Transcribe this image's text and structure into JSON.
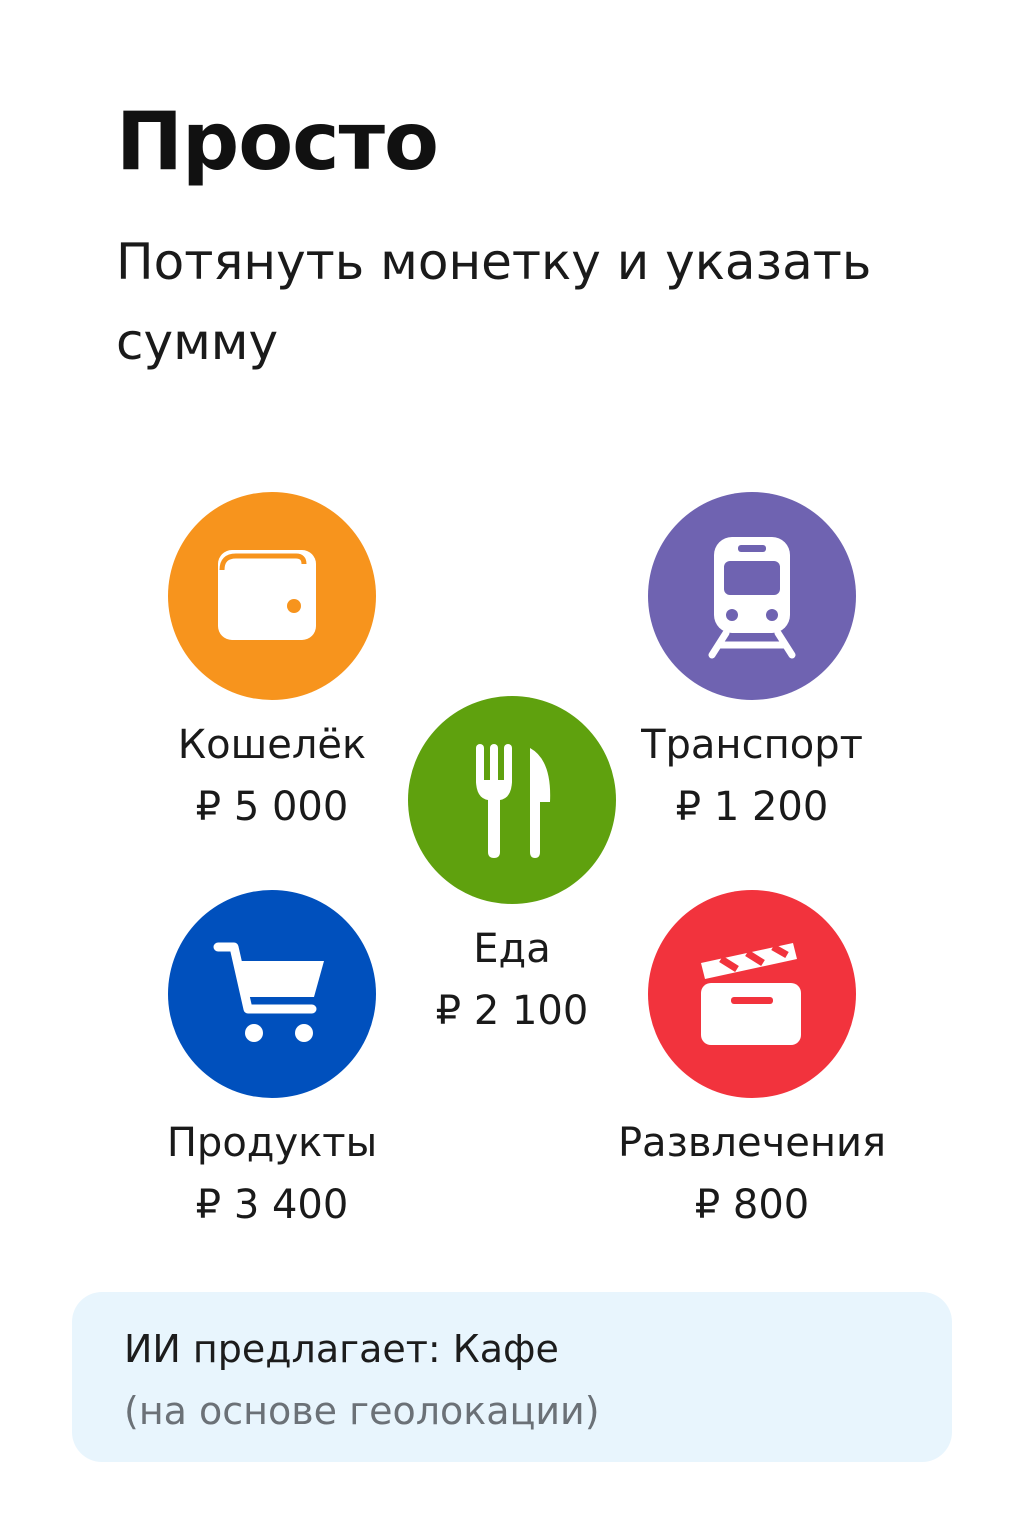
{
  "header": {
    "title": "Просто",
    "subtitle": "Потянуть монетку и указать сумму"
  },
  "categories": [
    {
      "name": "Кошелёк",
      "amount": "₽ 5 000",
      "icon": "wallet-icon",
      "color": "#f7941d"
    },
    {
      "name": "Транспорт",
      "amount": "₽ 1 200",
      "icon": "train-icon",
      "color": "#6f63b1"
    },
    {
      "name": "Еда",
      "amount": "₽ 2 100",
      "icon": "fork-knife-icon",
      "color": "#5fa10e"
    },
    {
      "name": "Продукты",
      "amount": "₽ 3 400",
      "icon": "shopping-cart-icon",
      "color": "#0050bd"
    },
    {
      "name": "Развлечения",
      "amount": "₽ 800",
      "icon": "clapperboard-icon",
      "color": "#f2333d"
    }
  ],
  "ai_suggestion": {
    "text": "ИИ предлагает: Кафе",
    "note": "(на основе геолокации)",
    "background": "#e8f5fd"
  }
}
